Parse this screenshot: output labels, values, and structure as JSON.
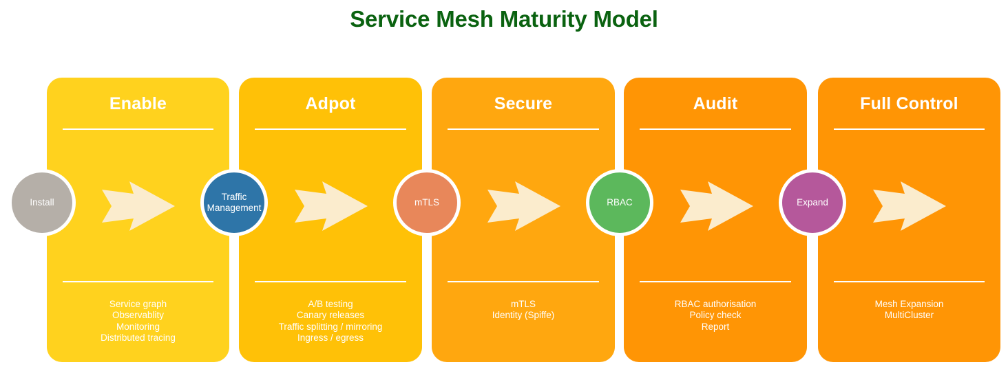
{
  "title": "Service Mesh Maturity Model",
  "theme": {
    "title_color": "#0a6210",
    "arrow_color": "#fbeccd",
    "ring_color": "#ffffff",
    "text_color": "#ffffff"
  },
  "stages": [
    {
      "id": "enable",
      "title": "Enable",
      "color": "#ffd21e",
      "items": [
        "Service graph",
        "Observablity",
        "Monitoring",
        "Distributed tracing"
      ]
    },
    {
      "id": "adopt",
      "title": "Adpot",
      "color": "#ffc107",
      "items": [
        "A/B testing",
        "Canary releases",
        "Traffic splitting / mirroring",
        "Ingress / egress"
      ]
    },
    {
      "id": "secure",
      "title": "Secure",
      "color": "#ffa70f",
      "items": [
        "mTLS",
        "Identity (Spiffe)"
      ]
    },
    {
      "id": "audit",
      "title": "Audit",
      "color": "#ff9505",
      "items": [
        "RBAC authorisation",
        "Policy check",
        "Report"
      ]
    },
    {
      "id": "full-control",
      "title": "Full Control",
      "color": "#ff9505",
      "items": [
        "Mesh Expansion",
        "MultiCluster"
      ]
    }
  ],
  "milestones": [
    {
      "id": "install",
      "label": "Install",
      "color": "#b5afa8",
      "label_lines": [
        "Install"
      ]
    },
    {
      "id": "traffic-management",
      "label": "Traffic Management",
      "color": "#2e75a8",
      "label_lines": [
        "Traffic",
        "Management"
      ]
    },
    {
      "id": "mtls",
      "label": "mTLS",
      "color": "#e8875a",
      "label_lines": [
        "mTLS"
      ]
    },
    {
      "id": "rbac",
      "label": "RBAC",
      "color": "#5cb85c",
      "label_lines": [
        "RBAC"
      ]
    },
    {
      "id": "expand",
      "label": "Expand",
      "color": "#b5589b",
      "label_lines": [
        "Expand"
      ]
    }
  ],
  "arrows": [
    {
      "id": "arrow-install-to-traffic"
    },
    {
      "id": "arrow-traffic-to-mtls"
    },
    {
      "id": "arrow-mtls-to-rbac"
    },
    {
      "id": "arrow-rbac-to-expand"
    },
    {
      "id": "arrow-expand-to-end"
    }
  ]
}
